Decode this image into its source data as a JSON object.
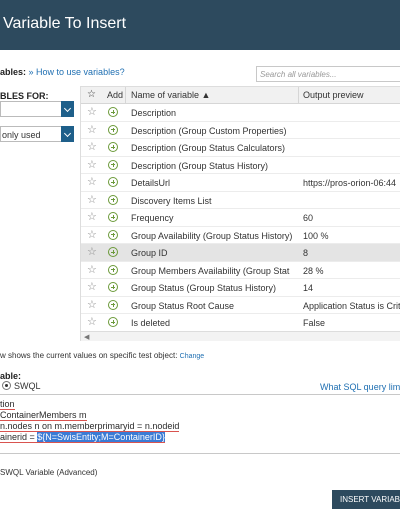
{
  "title": "Variable To Insert",
  "variables_label": "ables:",
  "help_link": "» How to use variables?",
  "search_placeholder": "Search all variables...",
  "left_panel": {
    "label": "BLES FOR:",
    "select1_value": "",
    "select2_value": "only used"
  },
  "grid": {
    "col_add": "Add",
    "col_name": "Name of variable ▲",
    "col_preview": "Output preview",
    "rows": [
      {
        "name": "Description",
        "preview": ""
      },
      {
        "name": "Description (Group Custom Properties)",
        "preview": ""
      },
      {
        "name": "Description (Group Status Calculators)",
        "preview": ""
      },
      {
        "name": "Description (Group Status History)",
        "preview": ""
      },
      {
        "name": "DetailsUrl",
        "preview": "https://pros-orion-06:44"
      },
      {
        "name": "Discovery Items List",
        "preview": ""
      },
      {
        "name": "Frequency",
        "preview": "60"
      },
      {
        "name": "Group Availability (Group Status History)",
        "preview": "100 %"
      },
      {
        "name": "Group ID",
        "preview": "8"
      },
      {
        "name": "Group Members Availability (Group Stat",
        "preview": "28 %"
      },
      {
        "name": "Group Status (Group Status History)",
        "preview": "14"
      },
      {
        "name": "Group Status Root Cause",
        "preview": "Application Status is Crit"
      },
      {
        "name": "Is deleted",
        "preview": "False"
      }
    ]
  },
  "test_text": "w shows the current values on specific test object:",
  "test_link": "Change",
  "variable_label": "able:",
  "radio_label": "SWQL",
  "sql_link": "What SQL query lim",
  "code_lines": {
    "line1": "tion",
    "line2": "ContainerMembers m",
    "line3": "n.nodes n on m.memberprimaryid = n.nodeid",
    "line4_prefix": "ainerid = ",
    "line4_highlight": "${N=SwisEntity;M=ContainerID}"
  },
  "footer_label": "SWQL Variable (Advanced)",
  "insert_button": "INSERT VARIABL"
}
